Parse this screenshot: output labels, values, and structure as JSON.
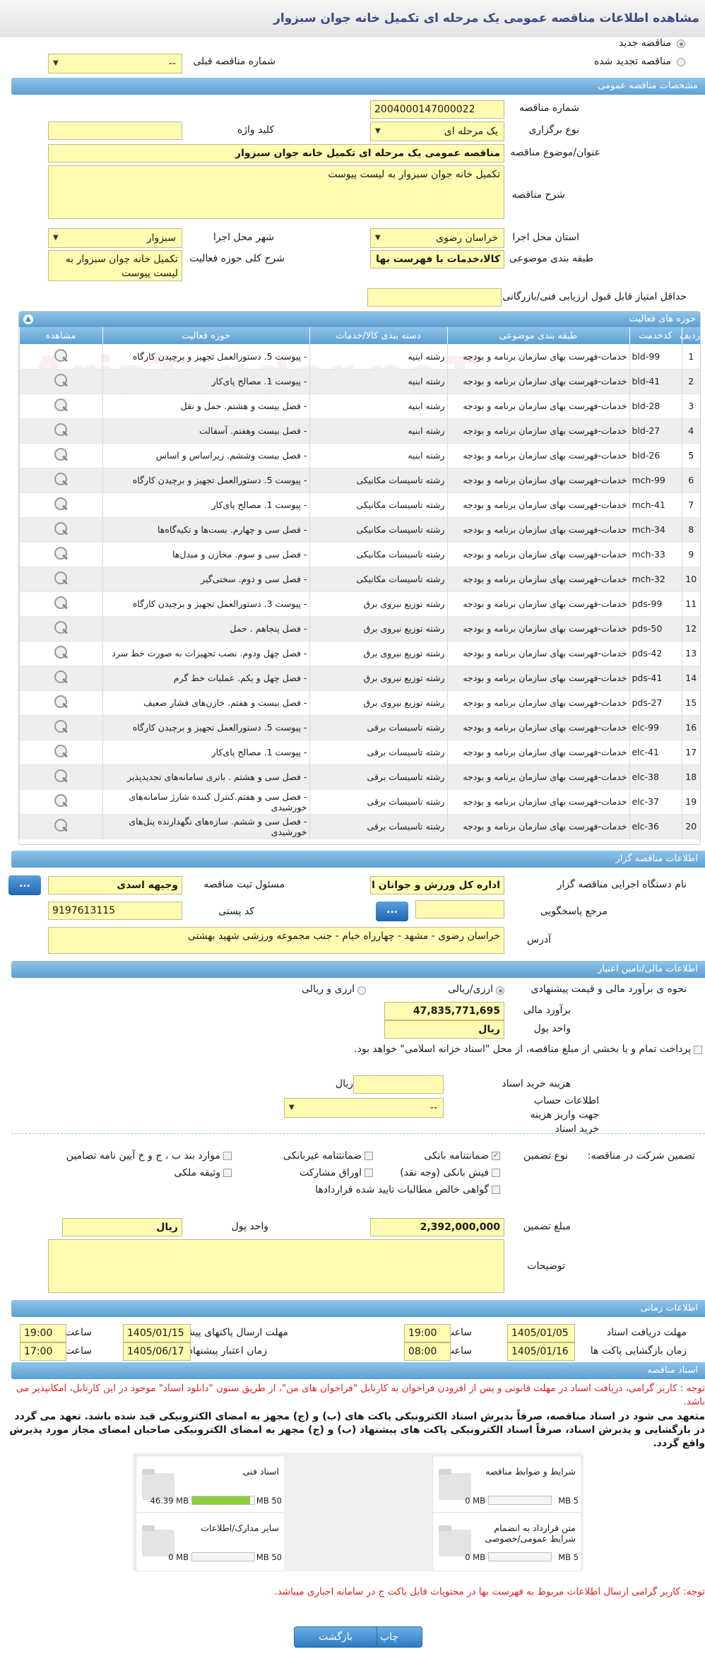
{
  "page_title": "مشاهده اطلاعات مناقصه عمومی یک مرحله ای تکمیل خانه جوان سبزوار",
  "tender_type": {
    "new": "مناقصه جدید",
    "renewed": "مناقصه تجدید شده",
    "prev_label": "شماره مناقصه قبلی",
    "prev_value": "--"
  },
  "watermark": "AriaTender.neT",
  "sec_general": {
    "title": "مشخصات مناقصه عمومی",
    "number_label": "شماره مناقصه",
    "number": "2004000147000022",
    "method_label": "نوع برگزاری",
    "method": "یک مرحله ای",
    "keyword_label": "کلید واژه",
    "keyword": "",
    "subject_label": "عنوان/موضوع مناقصه",
    "subject": "مناقصه عمومی یک مرحله ای تکمیل خانه جوان سبزوار",
    "desc_label": "شرح مناقصه",
    "desc": "تکمیل خانه جوان سبزوار به لیست پیوست",
    "province_label": "استان محل اجرا",
    "province": "خراسان رضوی",
    "city_label": "شهر محل اجرا",
    "city": "سبزوار",
    "category_label": "طبقه بندی موضوعی",
    "category": "کالا،خدمات با فهرست بها",
    "scope_label": "شرح کلی حوزه فعالیت",
    "scope": "تکمیل خانه جوان سبزوار به لیست پیوست",
    "min_score_label": "حداقل امتیاز قابل قبول ارزیابی فنی/بازرگانی",
    "min_score": ""
  },
  "activities": {
    "title": "حوزه های فعالیت",
    "headers": [
      "ردیف",
      "کدخدمت",
      "طبقه بندی موضوعی",
      "دسته بندی کالا/خدمات",
      "حوزه فعالیت",
      "مشاهده"
    ],
    "rows": [
      [
        "1",
        "bld-99",
        "خدمات-فهرست بهای سازمان برنامه و بودجه",
        "رشته ابنیه",
        "- پیوست 5. دستورالعمل تجهیز و برچیدن کارگاه"
      ],
      [
        "2",
        "bld-41",
        "خدمات-فهرست بهای سازمان برنامه و بودجه",
        "رشته ابنیه",
        "- پیوست 1. مصالح پای‌کار"
      ],
      [
        "3",
        "bld-28",
        "خدمات-فهرست بهای سازمان برنامه و بودجه",
        "رشته ابنیه",
        "- فصل بیست و هشتم. حمل و نقل"
      ],
      [
        "4",
        "bld-27",
        "خدمات-فهرست بهای سازمان برنامه و بودجه",
        "رشته ابنیه",
        "- فصل بیست وهفتم. آسفالت"
      ],
      [
        "5",
        "bld-26",
        "خدمات-فهرست بهای سازمان برنامه و بودجه",
        "رشته ابنیه",
        "- فصل بیست وششم. زیراساس و اساس"
      ],
      [
        "6",
        "mch-99",
        "خدمات-فهرست بهای سازمان برنامه و بودجه",
        "رشته تاسیسات مکانیکی",
        "- پیوست 5. دستورالعمل تجهیز و برچیدن کارگاه"
      ],
      [
        "7",
        "mch-41",
        "خدمات-فهرست بهای سازمان برنامه و بودجه",
        "رشته تاسیسات مکانیکی",
        "- پیوست 1. مصالح پای‌کار"
      ],
      [
        "8",
        "mch-34",
        "خدمات-فهرست بهای سازمان برنامه و بودجه",
        "رشته تاسیسات مکانیکی",
        "- فصل سی و چهارم. بست‌ها و تکیه‌گاه‌ها"
      ],
      [
        "9",
        "mch-33",
        "خدمات-فهرست بهای سازمان برنامه و بودجه",
        "رشته تاسیسات مکانیکی",
        "- فصل سی و سوم. مخازن و مبدل‌ها"
      ],
      [
        "10",
        "mch-32",
        "خدمات-فهرست بهای سازمان برنامه و بودجه",
        "رشته تاسیسات مکانیکی",
        "- فصل سی و دوم. سختی‌گیر"
      ],
      [
        "11",
        "pds-99",
        "خدمات-فهرست بهای سازمان برنامه و بودجه",
        "رشته توزیع نیروی برق",
        "- پیوست 3. دستورالعمل تجهیز و برچیدن کارگاه"
      ],
      [
        "12",
        "pds-50",
        "خدمات-فهرست بهای سازمان برنامه و بودجه",
        "رشته توزیع نیروی برق",
        "- فصل پنجاهم . حمل"
      ],
      [
        "13",
        "pds-42",
        "خدمات-فهرست بهای سازمان برنامه و بودجه",
        "رشته توزیع نیروی برق",
        "- فصل چهل ودوم. نصب تجهیزات به صورت خط سرد"
      ],
      [
        "14",
        "pds-41",
        "خدمات-فهرست بهای سازمان برنامه و بودجه",
        "رشته توزیع نیروی برق",
        "- فصل چهل و یکم. عملیات خط گرم"
      ],
      [
        "15",
        "pds-27",
        "خدمات-فهرست بهای سازمان برنامه و بودجه",
        "رشته توزیع نیروی برق",
        "- فصل بیست و هفتم. خازن‌های فشار ضعیف"
      ],
      [
        "16",
        "elc-99",
        "خدمات-فهرست بهای سازمان برنامه و بودجه",
        "رشته تاسیسات برقی",
        "- پیوست 5. دستورالعمل تجهیز و برچیدن کارگاه"
      ],
      [
        "17",
        "elc-41",
        "خدمات-فهرست بهای سازمان برنامه و بودجه",
        "رشته تاسیسات برقی",
        "- پیوست 1. مصالح پای‌کار"
      ],
      [
        "18",
        "elc-38",
        "خدمات-فهرست بهای سازمان برنامه و بودجه",
        "رشته تاسیسات برقی",
        "- فصل سی و هشتم . باتری سامانه‌های تجدیدپذیر"
      ],
      [
        "19",
        "elc-37",
        "خدمات-فهرست بهای سازمان برنامه و بودجه",
        "رشته تاسیسات برقی",
        "- فصل سی و هفتم.کنترل کننده شارژ سامانه‌های خورشیدی"
      ],
      [
        "20",
        "elc-36",
        "خدمات-فهرست بهای سازمان برنامه و بودجه",
        "رشته تاسیسات برقی",
        "- فصل سی و ششم. سازه‌های نگهدارنده پنل‌های خورشیدی"
      ]
    ]
  },
  "sec_org": {
    "title": "اطلاعات مناقصه گزار",
    "org_label": "نام دستگاه اجرایی مناقصه گزار",
    "org": "اداره کل ورزش و جوانان استان",
    "resp_label": "مسئول ثبت مناقصه",
    "resp": "وجیهه اسدی",
    "ref_label": "مرجع پاسخگویی",
    "ref": "",
    "postal_label": "کد پستی",
    "postal": "9197613115",
    "addr_label": "آدرس",
    "addr": "خراسان رضوی - مشهد - چهارراه خیام - جنب مجموعه ورزشی شهید بهشتی",
    "btn": "..."
  },
  "sec_fin": {
    "title": "اطلاعات مالی/تامین اعتبار",
    "estimate_label": "نحوه ی برآورد مالی و قیمت پیشنهادی",
    "opt1": "ارزی/ریالی",
    "opt2": "ارزی و ریالی",
    "amount_label": "برآورد مالی",
    "amount": "47,835,771,695",
    "currency_label": "واحد پول",
    "currency": "ریال",
    "partial_text": "پرداخت تمام و یا بخشی از مبلغ مناقصه، از محل \"اسناد خزانه اسلامی\" خواهد بود.",
    "fee_label": "هزینه خرید اسناد",
    "fee_unit": "ریال",
    "fee": "",
    "account_label": "اطلاعات حساب جهت واریز هزینه خرید اسناد",
    "account": "--",
    "guar_label": "تضمین شرکت در مناقصه:",
    "guar_type_label": "نوع تضمین",
    "g1": "ضمانتنامه بانکی",
    "g2": "ضمانتنامه غیربانکی",
    "g3": "موارد بند ب ، ج و خ آیین نامه تضامین",
    "g4": "فیش بانکی (وجه نقد)",
    "g5": "اوراق مشارکت",
    "g6": "وثیقه ملکی",
    "g7": "گواهی خالص مطالبات تایید شده قراردادها",
    "gamount_label": "مبلغ تضمین",
    "gamount": "2,392,000,000",
    "gcur_label": "واحد پول",
    "gcur": "ریال",
    "notes_label": "توضیحات",
    "notes": ""
  },
  "sec_time": {
    "title": "اطلاعات زمانی",
    "recv_label": "مهلت دریافت اسناد",
    "recv_date": "1405/01/05",
    "recv_time": "19:00",
    "send_label": "مهلت ارسال پاکتهای پیشنهاد",
    "send_date": "1405/01/15",
    "send_time": "19:00",
    "open_label": "زمان بازگشایی پاکت ها",
    "open_date": "1405/01/16",
    "open_time": "08:00",
    "valid_label": "زمان اعتبار پیشنهاد",
    "valid_date": "1405/06/17",
    "valid_time": "17:00",
    "time_label": "ساعت"
  },
  "sec_docs": {
    "title": "اسناد مناقصه",
    "notice": "توجه : کاربر گرامی، دریافت اسناد در مهلت قانونی و پس از افزودن فراخوان به کارتابل \"فراخوان های من\"، از طریق ستون \"دانلود اسناد\" موجود در این کارتابل، امکانپذیر می باشد.",
    "bold_notice": "متعهد می شود در اسناد مناقصه، صرفاً بدپرش اسناد الکترونیکی پاکت های (ب) و (ج) مجهز به امضای الکترونیکی قید شده باشد. تعهد می گردد در بازگشایی و پذیرش اسناد، صرفاً اسناد الکترونیکی پاکت های پیشنهاد (ب) و (ج) مجهز به امضای الکترونیکی صاحبان امضای مجاز مورد پذیرش واقع گردد.",
    "items": [
      {
        "name": "شرایط و ضوابط مناقصه",
        "used": "0 MB",
        "max": "5 MB",
        "pct": 0
      },
      {
        "name": "اسناد فنی",
        "used": "46.39 MB",
        "max": "50 MB",
        "pct": 0.93
      },
      {
        "name": "متن قرارداد به انضمام شرایط عمومی/خصوصی",
        "used": "0 MB",
        "max": "5 MB",
        "pct": 0
      },
      {
        "name": "سایر مدارک/اطلاعات",
        "used": "0 MB",
        "max": "50 MB",
        "pct": 0
      }
    ],
    "footer_notice": "توجه: کاربر گرامی ارسال اطلاعات مربوط به فهرست بها در محتویات قابل پاکت ج در سامانه اجباری میباشد."
  },
  "buttons": {
    "print": "چاپ",
    "back": "بازگشت"
  }
}
